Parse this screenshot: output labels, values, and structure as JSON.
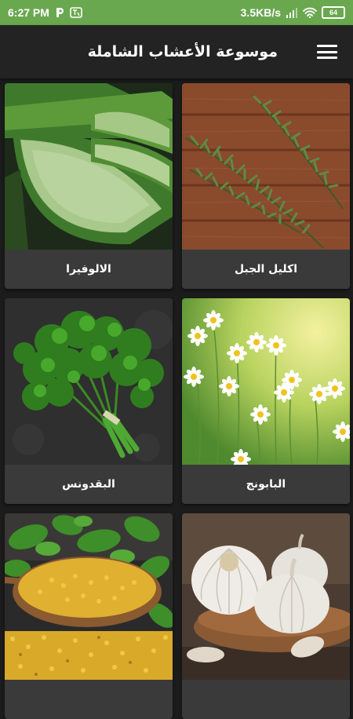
{
  "status_bar": {
    "time": "6:27 PM",
    "network_speed": "3.5KB/s",
    "battery": "64",
    "left_icons": [
      "p-notification-icon",
      "translate-icon"
    ],
    "right_icons": [
      "signal-icon",
      "wifi-icon",
      "battery-icon"
    ]
  },
  "app_bar": {
    "title": "موسوعة الأعشاب الشاملة",
    "menu_icon": "hamburger-menu-icon",
    "background": "#232323"
  },
  "colors": {
    "status_bar": "#6aa84f",
    "background": "#1c1c1c",
    "card": "#3a3a3a"
  },
  "herbs": [
    {
      "name": "اكليل الجبل",
      "image": "rosemary"
    },
    {
      "name": "الالوفيرا",
      "image": "aloe-vera"
    },
    {
      "name": "البابونج",
      "image": "chamomile"
    },
    {
      "name": "البقدونس",
      "image": "parsley"
    },
    {
      "name": "",
      "image": "garlic"
    },
    {
      "name": "",
      "image": "fenugreek"
    }
  ]
}
